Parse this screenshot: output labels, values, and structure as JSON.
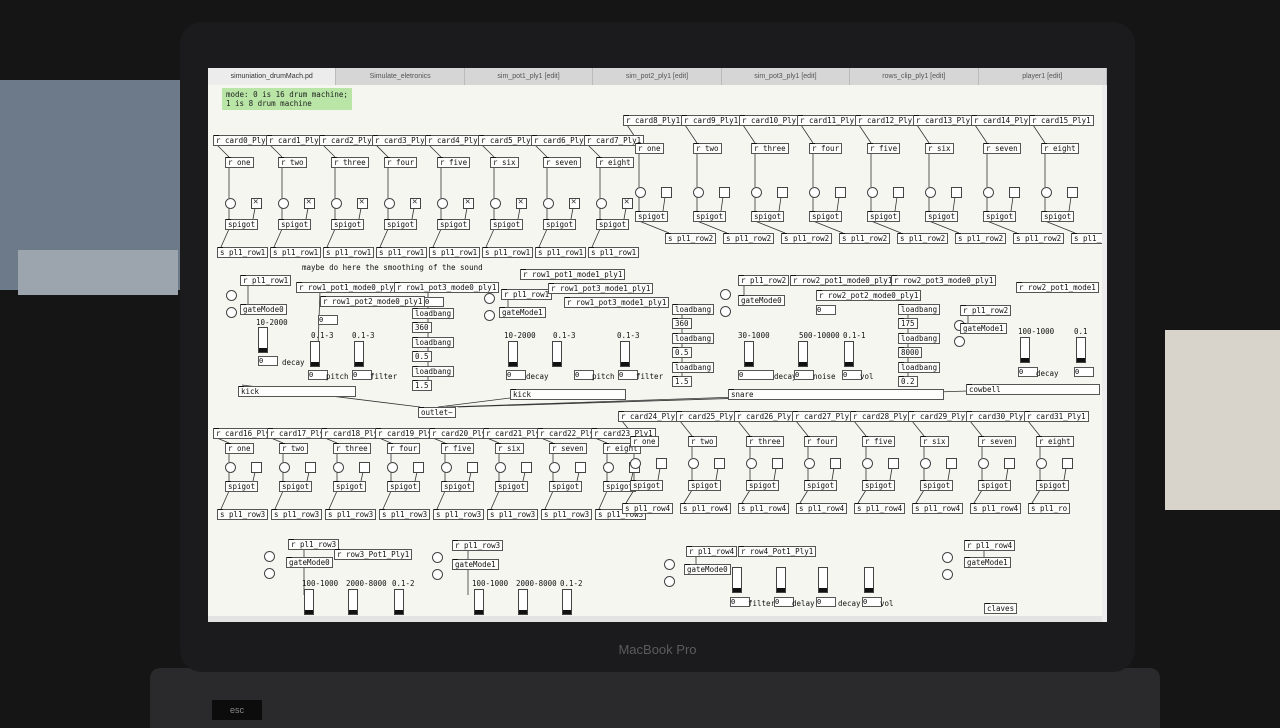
{
  "window": {
    "tabs": [
      {
        "label": "simuniation_drumMach.pd"
      },
      {
        "label": "Simulate_eletronics"
      },
      {
        "label": "sim_pot1_ply1 [edit]"
      },
      {
        "label": "sim_pot2_ply1 [edit]"
      },
      {
        "label": "sim_pot3_ply1 [edit]"
      },
      {
        "label": "rows_clip_ply1 [edit]"
      },
      {
        "label": "player1 [edit]"
      }
    ],
    "active_tab": 0
  },
  "device": {
    "brand": "MacBook Pro",
    "esc_label": "esc"
  },
  "patch": {
    "comment": "mode: 0 is 16 drum machine;\n1 is 8 drum machine",
    "note": "maybe do here the smoothing of the sound",
    "outlet": "outlet~",
    "recv_cards_row0": [
      "r card0_Ply1",
      "r card1_Ply1",
      "r card2_Ply1",
      "r card3_Ply1",
      "r card4_Ply1",
      "r card5_Ply1",
      "r card6_Ply1",
      "r card7_Ply1"
    ],
    "recv_cards_row1": [
      "r card8_Ply1",
      "r card9_Ply1",
      "r card10_Ply1",
      "r card11_Ply1",
      "r card12_Ply1",
      "r card13_Ply1",
      "r card14_Ply1",
      "r card15_Ply1"
    ],
    "recv_cards_row2": [
      "r card16_Ply1",
      "r card17_Ply1",
      "r card18_Ply1",
      "r card19_Ply1",
      "r card20_Ply1",
      "r card21_Ply1",
      "r card22_Ply1",
      "r card23_Ply1"
    ],
    "recv_cards_row3": [
      "r card24_Ply1",
      "r card25_Ply1",
      "r card26_Ply1",
      "r card27_Ply1",
      "r card28_Ply1",
      "r card29_Ply1",
      "r card30_Ply1",
      "r card31_Ply1"
    ],
    "step_names": [
      "r one",
      "r two",
      "r three",
      "r four",
      "r five",
      "r six",
      "r seven",
      "r eight"
    ],
    "spigot": "spigot",
    "send_row1": "s pl1_row1",
    "send_row2": "s pl1_row2",
    "send_row3": "s pl1_row3",
    "send_row4": "s pl1_row4",
    "send_row4_cut": "s pl1_ro",
    "synths": {
      "kick0": {
        "recv": "r pl1_row1",
        "mode": "gateMode0",
        "pot1": "r row1_pot1_mode0_ply1",
        "pot2": "r row1_pot2_mode0_ply1",
        "pot3": "r row1_pot3_mode0_ply1",
        "range1": "10-2000",
        "range2": "0.1-3",
        "range3": "0.1-3",
        "l1": "decay",
        "l2": "pitch",
        "l3": "filter",
        "name": "kick",
        "lb1": "loadbang",
        "lb2": "loadbang",
        "lb3": "loadbang",
        "v1": "360",
        "v2": "0.5",
        "v3": "1.5"
      },
      "kick1": {
        "recv": "r pl1_row1",
        "mode": "gateMode1",
        "pot1": "r row1_pot1_mode1_ply1",
        "pot2": "",
        "pot3": "r row1_pot3_mode1_ply1",
        "range1": "10-2000",
        "range2": "0.1-3",
        "range3": "0.1-3",
        "l1": "decay",
        "l2": "pitch",
        "l3": "filter",
        "name": "kick",
        "lb1": "loadbang",
        "lb2": "loadbang",
        "lb3": "loadbang",
        "v1": "360",
        "v2": "0.5",
        "v3": "1.5"
      },
      "snare": {
        "recv": "r pl1_row2",
        "mode": "gateMode0",
        "pot1": "r row2_pot1_mode0_ply1",
        "pot2": "r row2_pot2_mode0_ply1",
        "pot3": "r row2_pot3_mode0_ply1",
        "range1": "30-1000",
        "range2": "500-10000",
        "range3": "0.1-1",
        "l1": "decay",
        "l2": "noise",
        "l3": "vol",
        "name": "snare",
        "lb1": "loadbang",
        "lb2": "loadbang",
        "lb3": "loadbang",
        "v1": "175",
        "v2": "8000",
        "v3": "0.2"
      },
      "cowbell": {
        "recv": "r pl1_row2",
        "mode": "gateMode1",
        "pot1": "r row2_pot1_mode1",
        "range1": "100-1000",
        "range2": "0.1",
        "l1": "decay",
        "name": "cowbell"
      },
      "row3a": {
        "recv": "r pl1_row3",
        "mode": "gateMode0",
        "pot1": "r row3_Pot1_Ply1",
        "range1": "100-1000",
        "range2": "2000-8000",
        "range3": "0.1-2"
      },
      "row3b": {
        "recv": "r pl1_row3",
        "mode": "gateMode1",
        "range1": "100-1000",
        "range2": "2000-8000",
        "range3": "0.1-2"
      },
      "row4a": {
        "recv": "r pl1_row4",
        "mode": "gateMode0",
        "pot1": "r row4_Pot1_Ply1",
        "l1": "filter",
        "l2": "delay",
        "l3": "decay",
        "l4": "vol"
      },
      "row4b": {
        "recv": "r pl1_row4",
        "mode": "gateMode1",
        "name": "claves"
      }
    },
    "zero": "0"
  }
}
